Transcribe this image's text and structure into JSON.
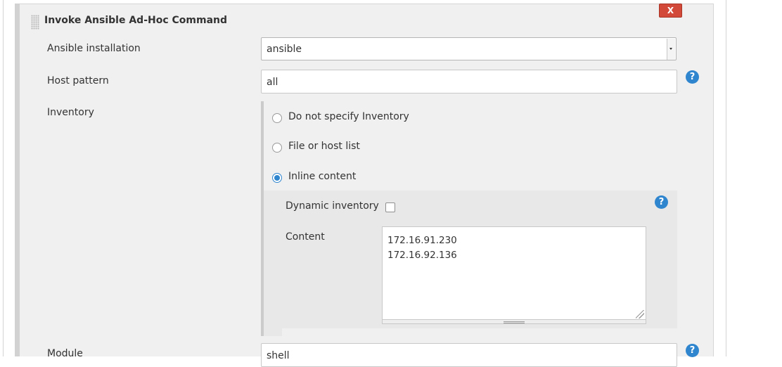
{
  "section": {
    "title": "Invoke Ansible Ad-Hoc Command",
    "close_label": "X"
  },
  "fields": {
    "ansible_installation": {
      "label": "Ansible installation",
      "value": "ansible"
    },
    "host_pattern": {
      "label": "Host pattern",
      "value": "all"
    },
    "inventory": {
      "label": "Inventory",
      "options": [
        {
          "label": "Do not specify Inventory",
          "checked": false
        },
        {
          "label": "File or host list",
          "checked": false
        },
        {
          "label": "Inline content",
          "checked": true
        }
      ],
      "dynamic_inventory": {
        "label": "Dynamic inventory",
        "checked": false
      },
      "content": {
        "label": "Content",
        "value": "172.16.91.230\n172.16.92.136"
      }
    },
    "module": {
      "label": "Module",
      "value": "shell"
    }
  },
  "help_icon_glyph": "?",
  "colors": {
    "accent": "#2f86cf",
    "close_button": "#d24939",
    "panel_bg": "#f0f0f0"
  }
}
